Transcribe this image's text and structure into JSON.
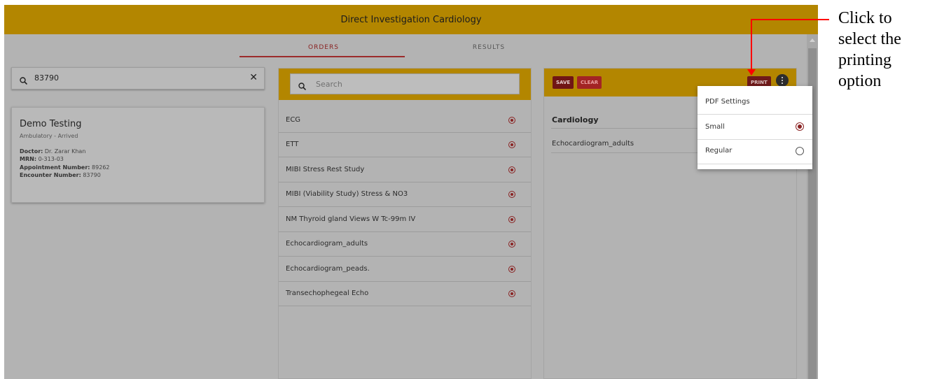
{
  "header": {
    "title": "Direct Investigation Cardiology"
  },
  "tabs": [
    {
      "label": "ORDERS",
      "active": true
    },
    {
      "label": "RESULTS",
      "active": false
    }
  ],
  "patient_search": {
    "value": "83790",
    "clear_icon": "close-icon",
    "search_icon": "search-icon"
  },
  "patient": {
    "name": "Demo Testing",
    "status": "Ambulatory - Arrived",
    "doctor_label": "Doctor:",
    "doctor": "Dr. Zarar Khan",
    "mrn_label": "MRN:",
    "mrn": "0-313-03",
    "appointment_label": "Appointment Number:",
    "appointment": "89262",
    "encounter_label": "Encounter Number:",
    "encounter": "83790"
  },
  "orders": {
    "search_placeholder": "Search",
    "items": [
      "ECG",
      "ETT",
      "MIBI Stress Rest Study",
      "MIBI (Viability Study) Stress & NO3",
      "NM Thyroid gland Views W Tc-99m IV",
      "Echocardiogram_adults",
      "Echocardiogram_peads.",
      "Transechophegeal Echo"
    ]
  },
  "cart": {
    "save_label": "SAVE",
    "clear_label": "CLEAR",
    "print_label": "PRINT",
    "heading": "Cardiology",
    "items": [
      "Echocardiogram_adults"
    ]
  },
  "pdf_menu": {
    "title": "PDF Settings",
    "options": [
      {
        "label": "Small",
        "selected": true
      },
      {
        "label": "Regular",
        "selected": false
      }
    ]
  },
  "annotation": {
    "text": "Click to select the printing option"
  },
  "colors": {
    "accent": "#b38600",
    "brand_red": "#8a2323",
    "annotation": "#ff0000"
  }
}
